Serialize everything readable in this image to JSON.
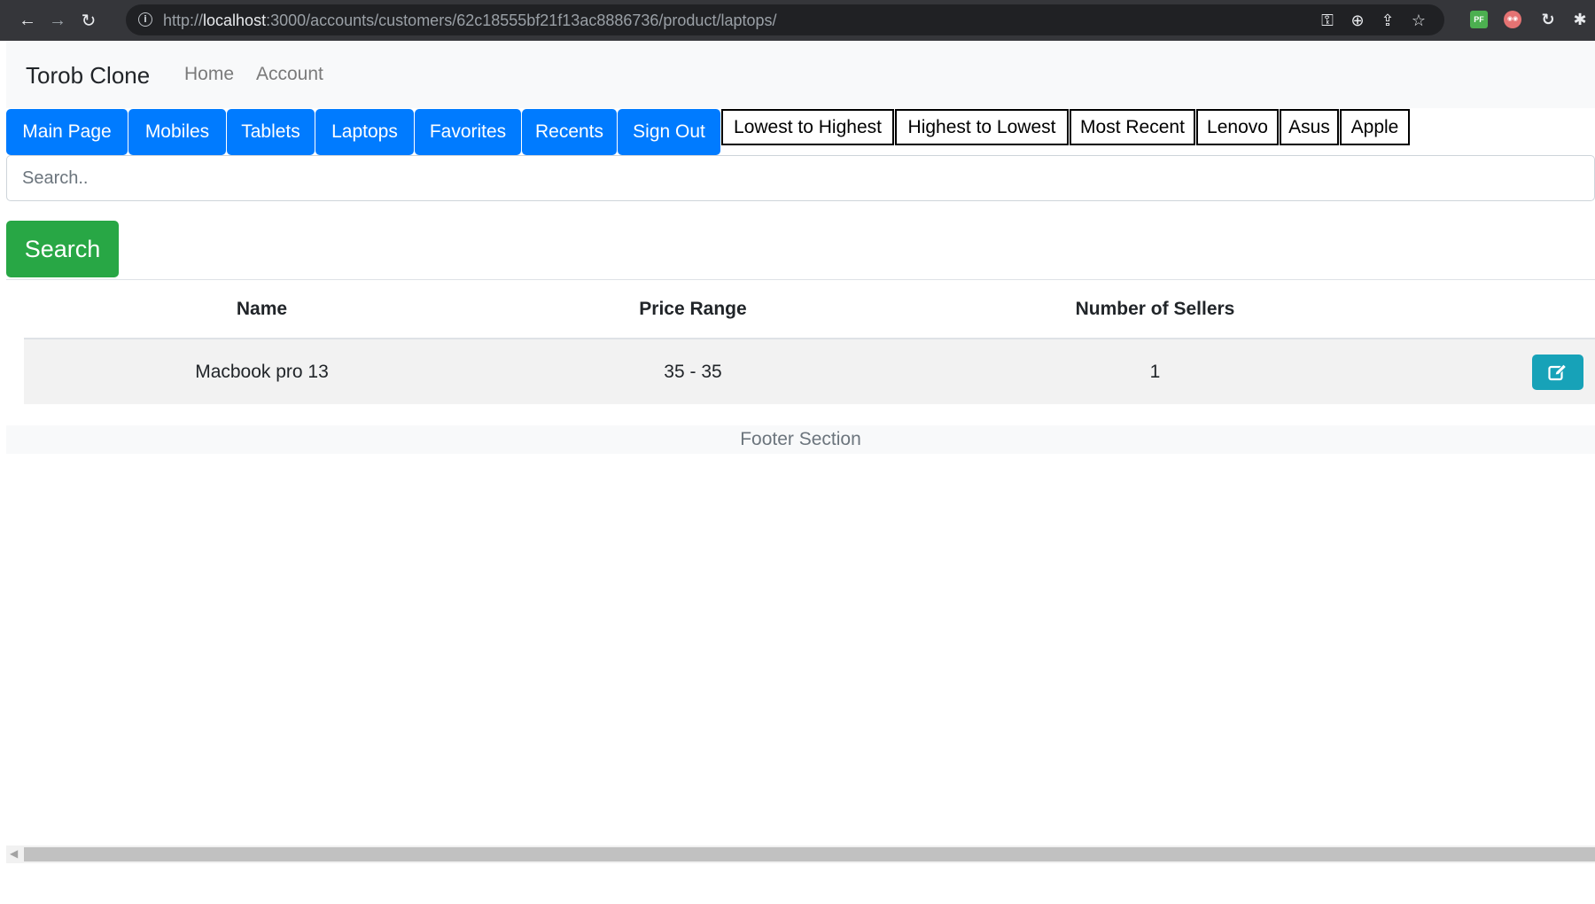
{
  "browser": {
    "url_prefix": "http://",
    "url_host": "localhost",
    "url_rest": ":3000/accounts/customers/62c18555bf21f13ac8886736/product/laptops/",
    "back": "←",
    "forward": "→",
    "reload": "↻",
    "info": "i",
    "key": "⚿",
    "zoom": "⊕",
    "share": "⇪",
    "star": "☆",
    "ext_pf": "PF",
    "ext_eyes": "◉◉",
    "ext_loop": "↻",
    "ext_puzzle": "✱"
  },
  "navbar": {
    "brand": "Torob Clone",
    "links": [
      "Home",
      "Account"
    ]
  },
  "menu_buttons": [
    "Main Page",
    "Mobiles",
    "Tablets",
    "Laptops",
    "Favorites",
    "Recents",
    "Sign Out"
  ],
  "filter_buttons": [
    "Lowest to Highest",
    "Highest to Lowest",
    "Most Recent",
    "Lenovo",
    "Asus",
    "Apple"
  ],
  "search": {
    "placeholder": "Search..",
    "button": "Search"
  },
  "table": {
    "headers": [
      "Name",
      "Price Range",
      "Number of Sellers"
    ],
    "rows": [
      {
        "name": "Macbook pro 13",
        "price_range": "35 - 35",
        "sellers": "1"
      }
    ]
  },
  "footer": "Footer Section",
  "colors": {
    "primary": "#007bff",
    "success": "#28a745",
    "info": "#17a2b8"
  }
}
